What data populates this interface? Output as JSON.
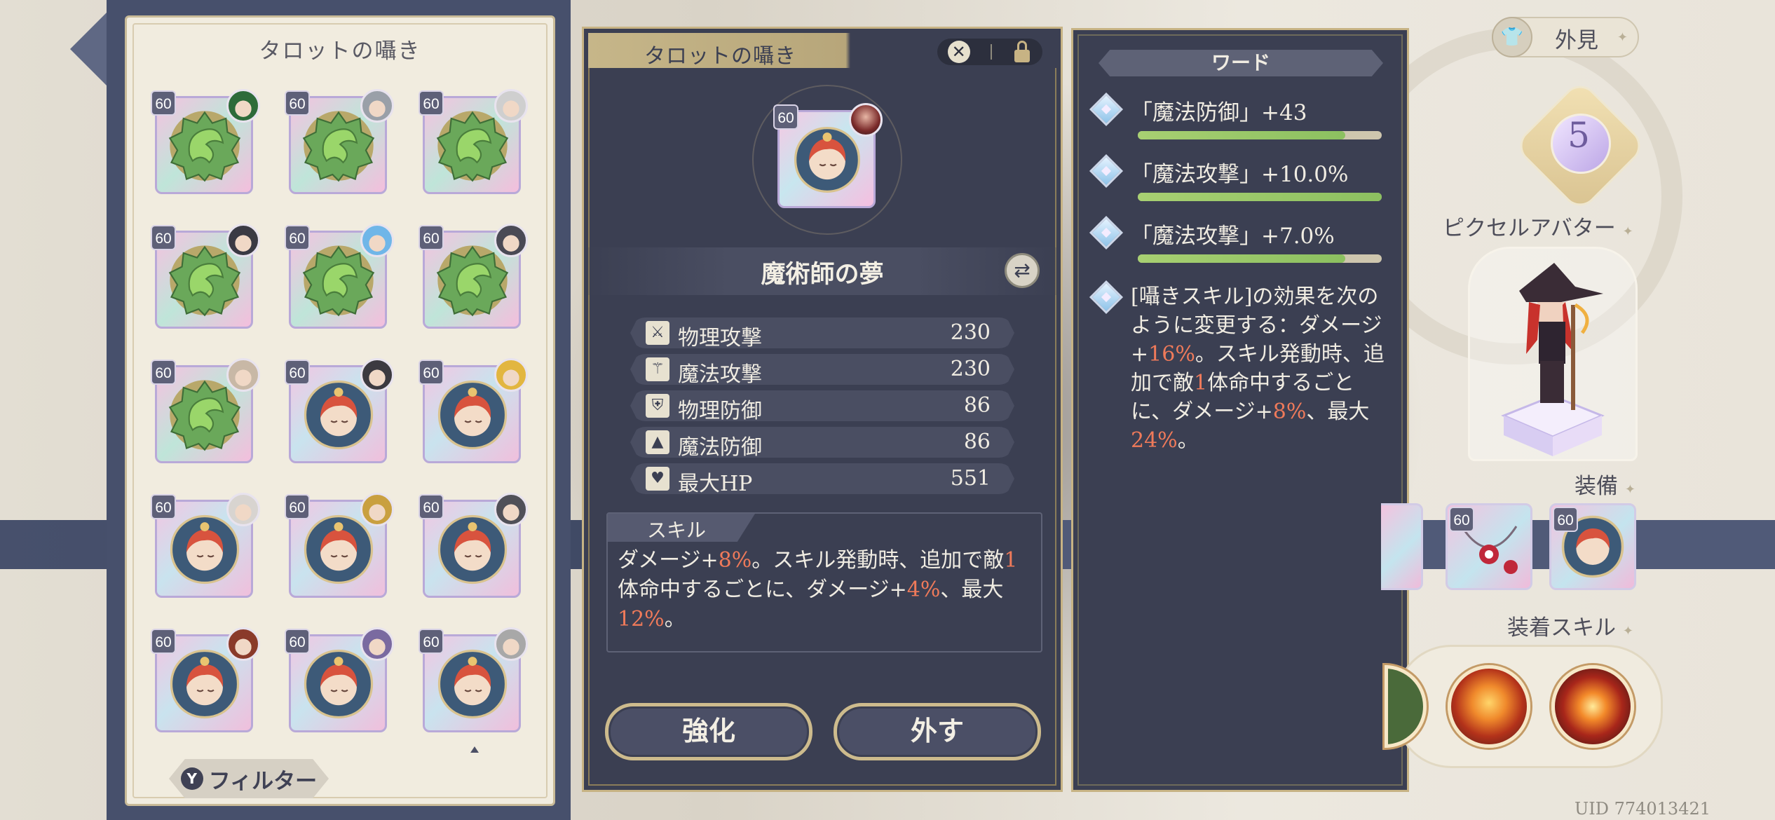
{
  "tarot_list": {
    "title": "タロットの囁き",
    "cards": [
      {
        "level": "60",
        "art": "green",
        "owner_color": "#2d6b3a"
      },
      {
        "level": "60",
        "art": "green",
        "owner_color": "#9aa0a8"
      },
      {
        "level": "60",
        "art": "green",
        "owner_color": "#cfcfcf"
      },
      {
        "level": "60",
        "art": "green",
        "owner_color": "#3a3a44"
      },
      {
        "level": "60",
        "art": "green",
        "owner_color": "#6fb6e8"
      },
      {
        "level": "60",
        "art": "green",
        "owner_color": "#4a4a55"
      },
      {
        "level": "60",
        "art": "green",
        "owner_color": "#c8b8a6"
      },
      {
        "level": "60",
        "art": "portrait",
        "owner_color": "#3c3a40"
      },
      {
        "level": "60",
        "art": "portrait",
        "owner_color": "#e2b640"
      },
      {
        "level": "60",
        "art": "portrait",
        "owner_color": "#d8d4d0"
      },
      {
        "level": "60",
        "art": "portrait",
        "owner_color": "#c9a040"
      },
      {
        "level": "60",
        "art": "portrait",
        "owner_color": "#505058"
      },
      {
        "level": "60",
        "art": "portrait",
        "owner_color": "#8a3a2a"
      },
      {
        "level": "60",
        "art": "portrait",
        "owner_color": "#7a6aa0"
      },
      {
        "level": "60",
        "art": "portrait",
        "owner_color": "#a8a8a8"
      }
    ],
    "filter_label": "フィルター",
    "filter_icon": "funnel-icon"
  },
  "detail": {
    "header_title": "タロットの囁き",
    "close_icon": "close-icon",
    "lock_icon": "unlock-icon",
    "card_level": "60",
    "name": "魔術師の夢",
    "stats": [
      {
        "icon": "sword-icon",
        "glyph": "⚔",
        "label": "物理攻撃",
        "value": "230"
      },
      {
        "icon": "wand-icon",
        "glyph": "⚚",
        "label": "魔法攻撃",
        "value": "230"
      },
      {
        "icon": "shield-icon",
        "glyph": "⛨",
        "label": "物理防御",
        "value": "86"
      },
      {
        "icon": "hat-icon",
        "glyph": "▲",
        "label": "魔法防御",
        "value": "86"
      },
      {
        "icon": "heart-icon",
        "glyph": "♥",
        "label": "最大HP",
        "value": "551"
      }
    ],
    "skill_label": "スキル",
    "skill_parts": [
      {
        "t": "ダメージ+",
        "h": false
      },
      {
        "t": "8%",
        "h": true
      },
      {
        "t": "。スキル発動時、追加で敵",
        "h": false
      },
      {
        "t": "1",
        "h": true
      },
      {
        "t": "体命中するごとに、ダメージ+",
        "h": false
      },
      {
        "t": "4%",
        "h": true
      },
      {
        "t": "、最大",
        "h": false
      },
      {
        "t": "12%",
        "h": true
      },
      {
        "t": "。",
        "h": false
      }
    ],
    "enhance_label": "強化",
    "remove_label": "外す"
  },
  "words": {
    "title": "ワード",
    "items": [
      {
        "text": "「魔法防御」+43",
        "progress": 0.85
      },
      {
        "text": "「魔法攻撃」+10.0%",
        "progress": 1.0
      },
      {
        "text": "「魔法攻撃」+7.0%",
        "progress": 0.85
      }
    ],
    "skill_parts": [
      {
        "t": "[囁きスキル]の効果を次のように変更する：ダメージ+",
        "h": false
      },
      {
        "t": "16%",
        "h": true
      },
      {
        "t": "。スキル発動時、追加で敵",
        "h": false
      },
      {
        "t": "1",
        "h": true
      },
      {
        "t": "体命中するごとに、ダメージ+",
        "h": false
      },
      {
        "t": "8%",
        "h": true
      },
      {
        "t": "、最大",
        "h": false
      },
      {
        "t": "24%",
        "h": true
      },
      {
        "t": "。",
        "h": false
      }
    ]
  },
  "avatar": {
    "appearance_label": "外見",
    "level": "5",
    "pixel_avatar_label": "ピクセルアバター",
    "equip_label": "装備",
    "equip_levels": [
      "60",
      "60"
    ],
    "equip_skill_label": "装着スキル",
    "uid": "UID 774013421"
  },
  "colors": {
    "panel_dark": "#3b3f52",
    "gold_border": "#c7b384",
    "highlight": "#ef7a5a",
    "progress_green": "#a8d072"
  }
}
